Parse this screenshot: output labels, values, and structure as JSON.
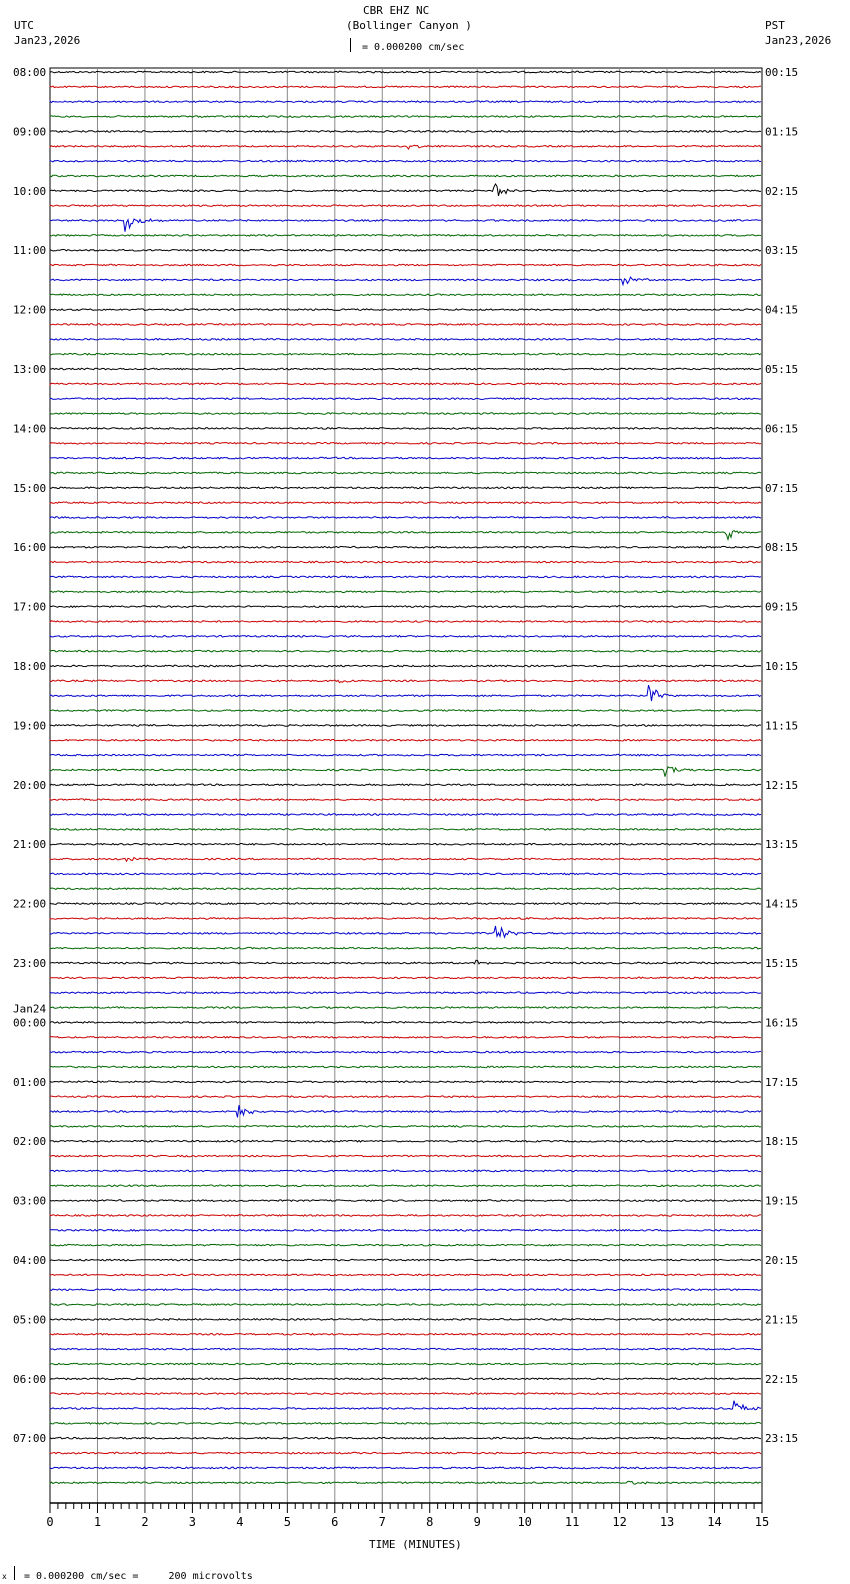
{
  "header": {
    "station": "CBR EHZ NC",
    "location": "(Bollinger Canyon )",
    "scale": "= 0.000200 cm/sec",
    "left_tz": "UTC",
    "left_date": "Jan23,2026",
    "right_tz": "PST",
    "right_date": "Jan23,2026"
  },
  "footer": {
    "scale_note": "= 0.000200 cm/sec =     200 microvolts",
    "prefix": "x"
  },
  "chart_data": {
    "type": "line",
    "title": "CBR EHZ NC (Bollinger Canyon )",
    "xlabel": "TIME (MINUTES)",
    "xlim": [
      0,
      15
    ],
    "x_ticks": [
      "0",
      "1",
      "2",
      "3",
      "4",
      "5",
      "6",
      "7",
      "8",
      "9",
      "10",
      "11",
      "12",
      "13",
      "14",
      "15"
    ],
    "traces_per_hour": 4,
    "trace_colors": [
      "#000000",
      "#cc0000",
      "#0000cc",
      "#006600"
    ],
    "left_labels": [
      "08:00",
      "09:00",
      "10:00",
      "11:00",
      "12:00",
      "13:00",
      "14:00",
      "15:00",
      "16:00",
      "17:00",
      "18:00",
      "19:00",
      "20:00",
      "21:00",
      "22:00",
      "23:00",
      "00:00",
      "01:00",
      "02:00",
      "03:00",
      "04:00",
      "05:00",
      "06:00",
      "07:00"
    ],
    "date_change": {
      "hour_index": 16,
      "label": "Jan24"
    },
    "right_labels": [
      "00:15",
      "01:15",
      "02:15",
      "03:15",
      "04:15",
      "05:15",
      "06:15",
      "07:15",
      "08:15",
      "09:15",
      "10:15",
      "11:15",
      "12:15",
      "13:15",
      "14:15",
      "15:15",
      "16:15",
      "17:15",
      "18:15",
      "19:15",
      "20:15",
      "21:15",
      "22:15",
      "23:15"
    ],
    "events": [
      {
        "trace": 5,
        "minute": 7.55,
        "amp": 4
      },
      {
        "trace": 8,
        "minute": 9.4,
        "amp": 8
      },
      {
        "trace": 10,
        "minute": 1.6,
        "amp": 12
      },
      {
        "trace": 14,
        "minute": 12.1,
        "amp": 6
      },
      {
        "trace": 31,
        "minute": 14.3,
        "amp": 7
      },
      {
        "trace": 41,
        "minute": 6.1,
        "amp": 3
      },
      {
        "trace": 42,
        "minute": 12.6,
        "amp": 13
      },
      {
        "trace": 47,
        "minute": 13.0,
        "amp": 7
      },
      {
        "trace": 53,
        "minute": 1.6,
        "amp": 4
      },
      {
        "trace": 58,
        "minute": 9.4,
        "amp": 11
      },
      {
        "trace": 60,
        "minute": 9.0,
        "amp": 4
      },
      {
        "trace": 70,
        "minute": 4.0,
        "amp": 9
      },
      {
        "trace": 90,
        "minute": 14.4,
        "amp": 8
      },
      {
        "trace": 95,
        "minute": 12.2,
        "amp": 4
      }
    ]
  }
}
